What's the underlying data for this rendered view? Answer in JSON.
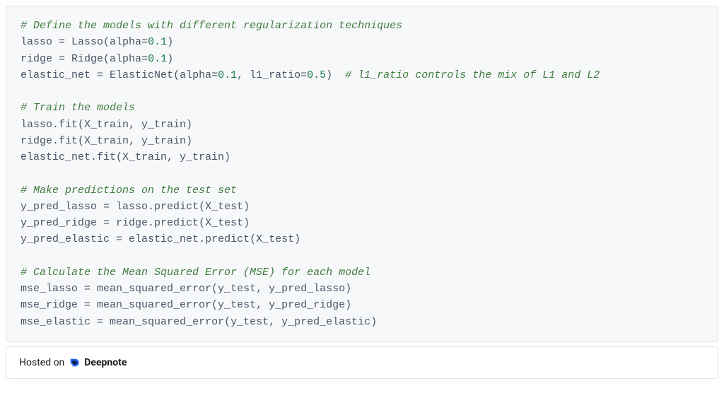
{
  "code": {
    "c1": "# Define the models with different regularization techniques",
    "l1a": "lasso ",
    "l1b": " Lasso(alpha",
    "l1c": "0.1",
    "l1d": ")",
    "l2a": "ridge ",
    "l2b": " Ridge(alpha",
    "l2c": "0.1",
    "l2d": ")",
    "l3a": "elastic_net ",
    "l3b": " ElasticNet(alpha",
    "l3c": "0.1",
    "l3d": ", l1_ratio",
    "l3e": "0.5",
    "l3f": ")  ",
    "l3g": "# l1_ratio controls the mix of L1 and L2",
    "c2": "# Train the models",
    "l4": "lasso.fit(X_train, y_train)",
    "l5": "ridge.fit(X_train, y_train)",
    "l6": "elastic_net.fit(X_train, y_train)",
    "c3": "# Make predictions on the test set",
    "l7a": "y_pred_lasso ",
    "l7b": " lasso.predict(X_test)",
    "l8a": "y_pred_ridge ",
    "l8b": " ridge.predict(X_test)",
    "l9a": "y_pred_elastic ",
    "l9b": " elastic_net.predict(X_test)",
    "c4": "# Calculate the Mean Squared Error (MSE) for each model",
    "l10a": "mse_lasso ",
    "l10b": " mean_squared_error(y_test, y_pred_lasso)",
    "l11a": "mse_ridge ",
    "l11b": " mean_squared_error(y_test, y_pred_ridge)",
    "l12a": "mse_elastic ",
    "l12b": " mean_squared_error(y_test, y_pred_elastic)",
    "eq": "="
  },
  "footer": {
    "hosted": "Hosted on",
    "brand": "Deepnote"
  }
}
